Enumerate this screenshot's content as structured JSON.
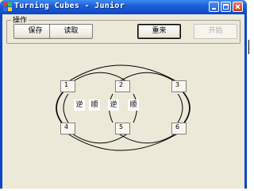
{
  "window": {
    "title": "Turning Cubes - Junior",
    "title_bar_color": "#0a47c7",
    "icons": [
      "app-icon",
      "minimize-icon",
      "maximize-icon",
      "close-icon"
    ]
  },
  "operations": {
    "label": "操作",
    "buttons": {
      "save": "保存",
      "load": "读取",
      "reset": "重来",
      "start": "开始"
    }
  },
  "cubes": {
    "c1": "1",
    "c2": "2",
    "c3": "3",
    "c4": "4",
    "c5": "5",
    "c6": "6"
  },
  "directions": {
    "left_ccw": "逆",
    "left_cw": "顺",
    "right_ccw": "逆",
    "right_cw": "顺"
  }
}
